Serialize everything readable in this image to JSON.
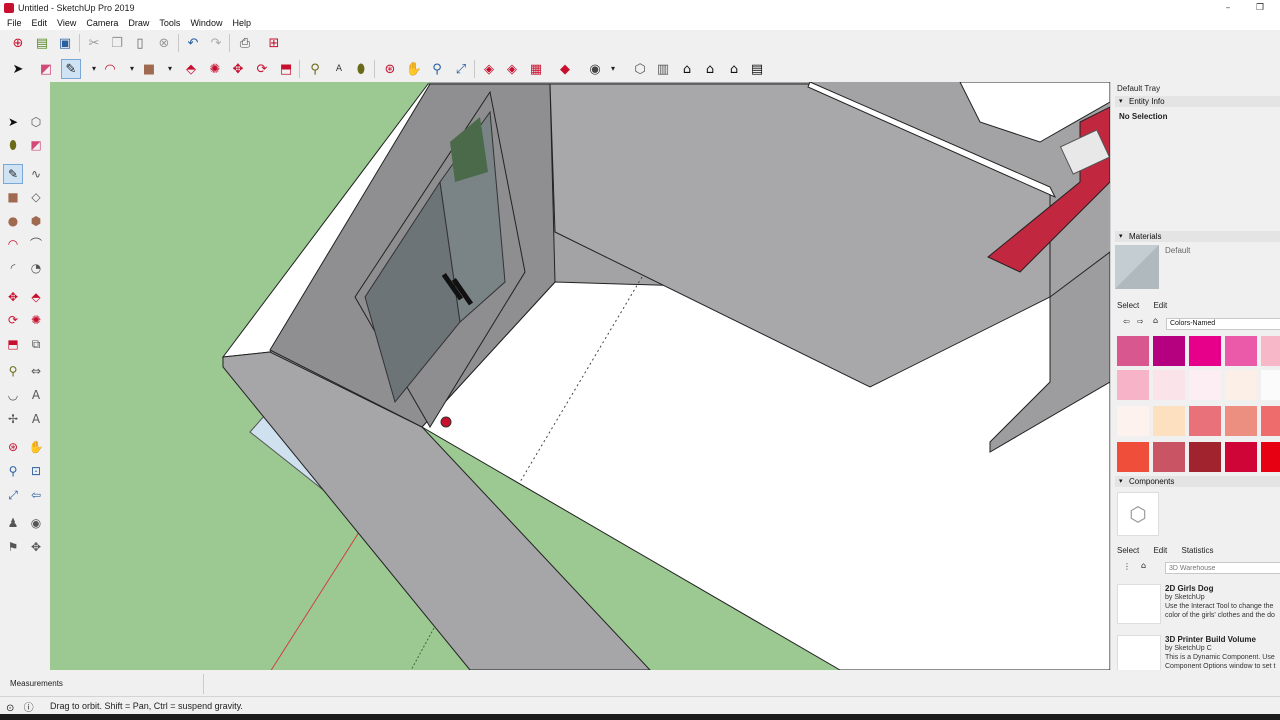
{
  "window": {
    "title": "Untitled - SketchUp Pro 2019",
    "minimize_glyph": "–",
    "restore_glyph": "❐"
  },
  "menu": [
    "File",
    "Edit",
    "View",
    "Camera",
    "Draw",
    "Tools",
    "Window",
    "Help"
  ],
  "toolbar_row1_icons": [
    "new-model-icon",
    "open-icon",
    "save-icon",
    "cut-icon",
    "copy-icon",
    "paste-icon",
    "erase-icon",
    "undo-icon",
    "redo-icon",
    "print-icon",
    "model-info-icon"
  ],
  "toolbar_row2_icons": [
    "select-icon",
    "eraser-icon",
    "line-icon",
    "arc-icon",
    "rectangle-icon",
    "push-pull-icon",
    "follow-me-icon",
    "move-icon",
    "rotate-icon",
    "scale-icon",
    "tape-measure-icon",
    "text-icon",
    "paint-bucket-icon",
    "orbit-icon",
    "pan-icon",
    "zoom-icon",
    "zoom-extents-icon",
    "3d-warehouse-icon",
    "extension-warehouse-icon",
    "layout-icon",
    "ruby-icon",
    "user-icon",
    "iso-view-icon",
    "top-view-icon",
    "front-view-icon",
    "right-view-icon",
    "back-view-icon",
    "left-view-icon"
  ],
  "left_toolbar_icons": [
    "select-icon",
    "component-icon",
    "paint-bucket-icon",
    "eraser-icon",
    "line-icon",
    "freehand-icon",
    "rectangle-icon",
    "rotated-rectangle-icon",
    "circle-icon",
    "polygon-icon",
    "arc-icon",
    "two-point-arc-icon",
    "three-point-arc-icon",
    "pie-icon",
    "move-icon",
    "push-pull-icon",
    "rotate-icon",
    "follow-me-icon",
    "scale-icon",
    "offset-icon",
    "tape-measure-icon",
    "dimension-icon",
    "protractor-icon",
    "text-icon",
    "axes-icon",
    "3d-text-icon",
    "orbit-icon",
    "pan-icon",
    "zoom-icon",
    "zoom-window-icon",
    "zoom-extents-icon",
    "previous-view-icon",
    "position-camera-icon",
    "look-around-icon",
    "walk-icon",
    "section-plane-icon"
  ],
  "tray": {
    "title": "Default Tray",
    "entity_info": {
      "header": "Entity Info",
      "status": "No Selection"
    },
    "materials": {
      "header": "Materials",
      "current": "Default",
      "tabs": [
        "Select",
        "Edit"
      ],
      "collection": "Colors-Named",
      "swatches": [
        "#d9578f",
        "#b5007f",
        "#e6008a",
        "#ea5aa8",
        "#f7b7c9",
        "#f7b3c8",
        "#fbe3ea",
        "#fdeef4",
        "#fbefe8",
        "#fbfbfb",
        "#fdf2ee",
        "#fce0c0",
        "#e9727a",
        "#ec8f80",
        "#ef6c6c",
        "#ef4e3a",
        "#c95564",
        "#a1232e",
        "#cf0537",
        "#e60012"
      ]
    },
    "components": {
      "header": "Components",
      "tabs": [
        "Select",
        "Edit",
        "Statistics"
      ],
      "search_placeholder": "3D Warehouse",
      "items": [
        {
          "name": "2D Girls Dog",
          "by": "by SketchUp",
          "desc1": "Use the Interact Tool to change the",
          "desc2": "color of the girls' clothes and the do"
        },
        {
          "name": "3D Printer Build Volume",
          "by": "by SketchUp C",
          "desc1": "This is a Dynamic Component. Use",
          "desc2": "Component Options window to set t"
        }
      ]
    }
  },
  "measurements_label": "Measurements",
  "status_text": "Drag to orbit. Shift = Pan, Ctrl = suspend gravity.",
  "colors": {
    "ground": "#9cc992",
    "wall": "#a3a3a5",
    "floor": "#ffffff",
    "accent_red": "#c1273f"
  }
}
